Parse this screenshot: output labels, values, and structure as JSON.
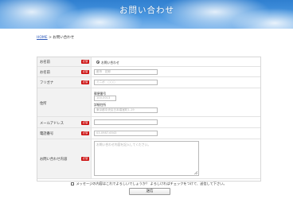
{
  "header": {
    "title": "お問い合わせ"
  },
  "breadcrumb": {
    "home": "HOME",
    "separator": " > ",
    "current": "お問い合わせ"
  },
  "form": {
    "rows": [
      {
        "label": "お名前",
        "required": "必須",
        "radio_label": "お問い合わせ"
      },
      {
        "label": "お名前",
        "required": "必須",
        "placeholder": "都市　花郎"
      },
      {
        "label": "フリガナ",
        "required": "必須",
        "placeholder": "ミニボ　○○○"
      },
      {
        "label": "住所",
        "postal_label": "郵便番号",
        "postal_placeholder": "100-0013",
        "address_label": "詳細住所",
        "address_placeholder": "東京都中央区日本橋室町1-19"
      },
      {
        "label": "メールアドレス",
        "required": "必須",
        "placeholder": ""
      },
      {
        "label": "電話番号",
        "required": "必須",
        "placeholder": "03-0987-6543"
      },
      {
        "label": "お問い合わせ内容",
        "required": "必須",
        "placeholder": "お問い合わせ内容を記入してください。"
      }
    ],
    "confirm_text": "メッセージの内容はこれでよろしいでしょうか？ よろしければチェックをつけて、送信して下さい。",
    "submit_label": "送信"
  },
  "colors": {
    "banner": "#4a97e0",
    "required_badge": "#cc1111",
    "link": "#2b57b8"
  }
}
